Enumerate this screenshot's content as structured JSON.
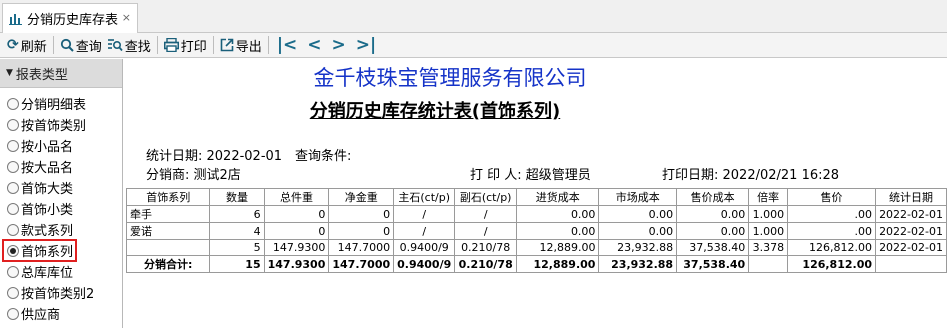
{
  "tab": {
    "title": "分销历史库存表",
    "close": "×"
  },
  "toolbar": {
    "refresh": "刷新",
    "query": "查询",
    "find": "查找",
    "print": "打印",
    "export": "导出"
  },
  "left_panel": {
    "header": "报表类型",
    "items": [
      "分销明细表",
      "按首饰类别",
      "按小品名",
      "按大品名",
      "首饰大类",
      "首饰小类",
      "款式系列",
      "首饰系列",
      "总库库位",
      "按首饰类别2",
      "供应商"
    ],
    "selected_index": 7
  },
  "report": {
    "company": "金千枝珠宝管理服务有限公司",
    "title": "分销历史库存统计表(首饰系列)",
    "stat_date": "统计日期:  2022-02-01",
    "query_cond": "查询条件:",
    "distributor": "分销商:  测试2店",
    "printer": "打 印 人:  超级管理员",
    "print_date": "打印日期:  2022/02/21 16:28",
    "columns": [
      "首饰系列",
      "数量",
      "总件重",
      "净金重",
      "主石(ct/p)",
      "副石(ct/p)",
      "进货成本",
      "市场成本",
      "售价成本",
      "倍率",
      "售价",
      "统计日期"
    ],
    "rows": [
      [
        "牵手",
        "6",
        "0",
        "0",
        "/",
        "/",
        "0.00",
        "0.00",
        "0.00",
        "1.000",
        ".00",
        "2022-02-01"
      ],
      [
        "爱诺",
        "4",
        "0",
        "0",
        "/",
        "/",
        "0.00",
        "0.00",
        "0.00",
        "1.000",
        ".00",
        "2022-02-01"
      ],
      [
        "",
        "5",
        "147.9300",
        "147.7000",
        "0.9400/9",
        "0.210/78",
        "12,889.00",
        "23,932.88",
        "37,538.40",
        "3.378",
        "126,812.00",
        "2022-02-01"
      ]
    ],
    "total": [
      "分销合计:",
      "15",
      "147.9300",
      "147.7000",
      "0.9400/9",
      "0.210/78",
      "12,889.00",
      "23,932.88",
      "37,538.40",
      "",
      "126,812.00",
      ""
    ]
  }
}
